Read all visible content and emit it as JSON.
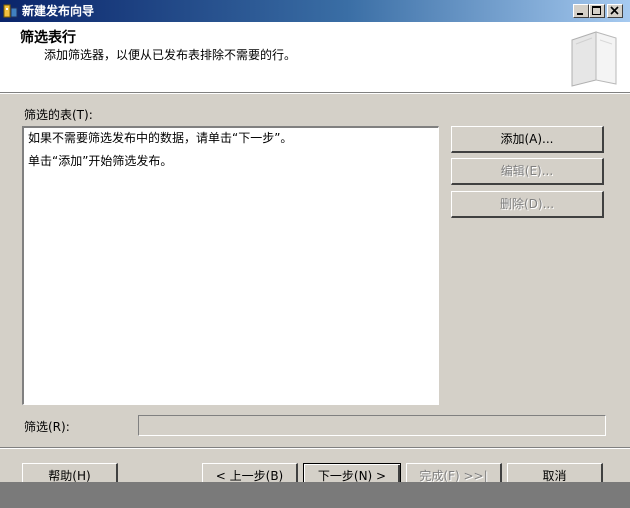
{
  "window": {
    "title": "新建发布向导"
  },
  "header": {
    "title": "筛选表行",
    "subtitle": "添加筛选器，以便从已发布表排除不需要的行。"
  },
  "filtered_tables": {
    "label": "筛选的表(T):",
    "lines": [
      "如果不需要筛选发布中的数据，请单击“下一步”。",
      "单击“添加”开始筛选发布。"
    ]
  },
  "side_buttons": {
    "add": "添加(A)...",
    "edit": "编辑(E)...",
    "delete": "删除(D)..."
  },
  "filter": {
    "label": "筛选(R):",
    "value": ""
  },
  "footer": {
    "help": "帮助(H)",
    "back": "< 上一步(B)",
    "next": "下一步(N) >",
    "finish": "完成(F) >>|",
    "cancel": "取消"
  },
  "colors": {
    "titlebar_start": "#0a246a",
    "titlebar_end": "#a6caf0",
    "dialog_face": "#d4d0c8",
    "disabled_text": "#808080"
  },
  "icons": [
    "app-icon",
    "minimize-icon",
    "maximize-icon",
    "close-icon",
    "wizard-book-icon"
  ]
}
